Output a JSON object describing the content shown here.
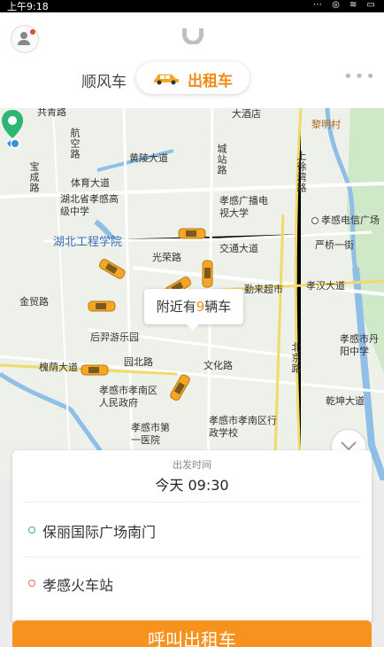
{
  "status_bar": {
    "time": "上午9:18",
    "icons": "⋯ ◎ ≋ ▭"
  },
  "header": {
    "tabs": [
      {
        "label": "顺风车"
      },
      {
        "label": "出租车"
      }
    ],
    "more_label": "•••"
  },
  "map": {
    "labels": {
      "hangkong_rd": "航空路",
      "huangling": "黄陵大道",
      "chengzhan": "城站路",
      "dajiudian": "大酒店",
      "liming": "黎明村",
      "shangxu": "上徐湾路",
      "baocheng": "宝成路",
      "tiyu": "体育大道",
      "hbxg": "湖北省孝感高级中学",
      "xgdianshi": "孝感广播电视大学",
      "xgdianxin": "孝感电信广场",
      "hbgcxy": "湖北工程学院",
      "jiaotong": "交通大道",
      "yanqiao": "严桥一街",
      "guangrong": "光荣路",
      "qinlai": "勤来超市",
      "xiaohan": "孝汉大道",
      "jinmao": "金贸路",
      "houyi": "后羿游乐园",
      "xgdanyang": "孝感市丹阳中学",
      "beijing": "北京路",
      "yuanbei": "园北路",
      "wenhua": "文化路",
      "huaiyin": "槐荫大道",
      "xgzf": "孝感市孝南区人民政府",
      "qianshui": "乾坤大道",
      "xgyy": "孝感市第一医院",
      "xgxz": "孝感市孝南区行政学校",
      "top_left": "共青路"
    },
    "nearby": {
      "prefix": "附近有",
      "count": "9",
      "suffix": "辆车"
    }
  },
  "panel": {
    "departure_label": "出发时间",
    "departure_time": "今天 09:30",
    "origin": "保丽国际广场南门",
    "destination": "孝感火车站"
  },
  "call_button_label": "呼叫出租车"
}
